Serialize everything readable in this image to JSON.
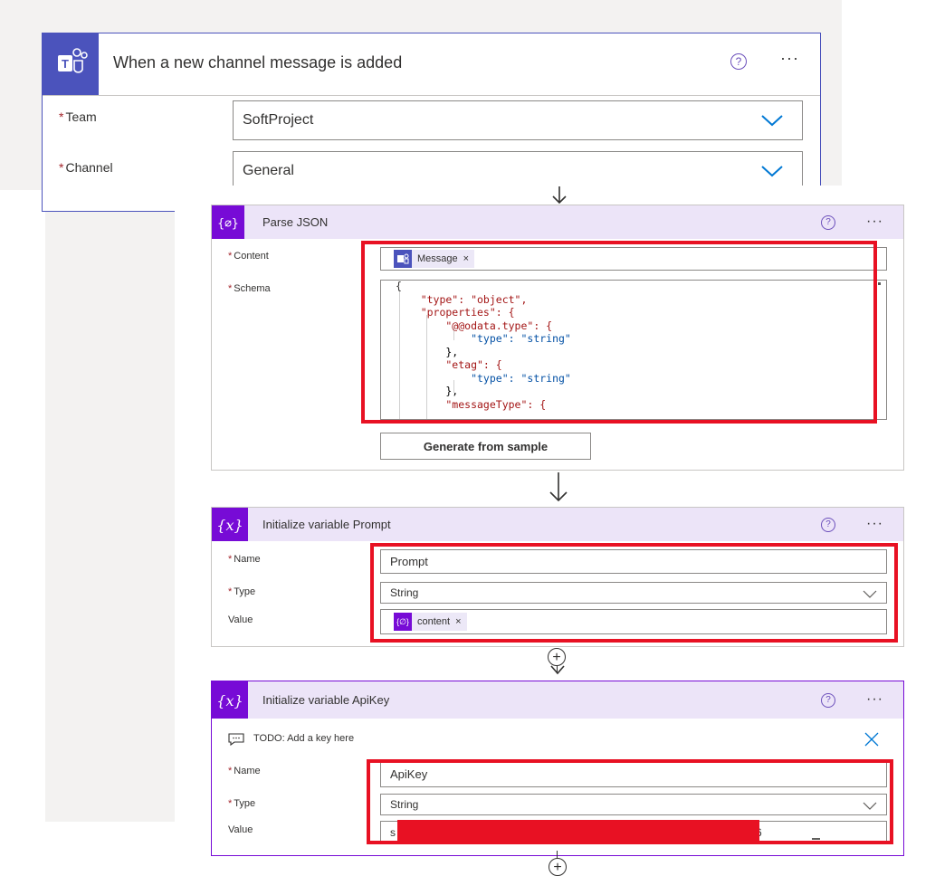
{
  "trigger": {
    "title": "When a new channel message is added",
    "team_label": "Team",
    "team_value": "SoftProject",
    "channel_label": "Channel",
    "channel_value": "General"
  },
  "parse_json": {
    "title": "Parse JSON",
    "content_label": "Content",
    "content_token": "Message",
    "schema_label": "Schema",
    "schema_lines": [
      "{",
      "    \"type\": \"object\",",
      "    \"properties\": {",
      "        \"@@odata.type\": {",
      "            \"type\": \"string\"",
      "        },",
      "        \"etag\": {",
      "            \"type\": \"string\"",
      "        },",
      "        \"messageType\": {"
    ],
    "generate_button": "Generate from sample"
  },
  "init_prompt": {
    "title": "Initialize variable Prompt",
    "name_label": "Name",
    "name_value": "Prompt",
    "type_label": "Type",
    "type_value": "String",
    "value_label": "Value",
    "value_token": "content"
  },
  "init_apikey": {
    "title": "Initialize variable ApiKey",
    "comment": "TODO: Add a key here",
    "name_label": "Name",
    "name_value": "ApiKey",
    "type_label": "Type",
    "type_value": "String",
    "value_label": "Value",
    "value_visible_start": "s",
    "value_visible_end": "6"
  },
  "required_mark": "*",
  "colors": {
    "teams_purple": "#4b53bc",
    "variable_purple": "#770bd6",
    "header_tint": "#ece4f8",
    "highlight_red": "#e81123"
  }
}
